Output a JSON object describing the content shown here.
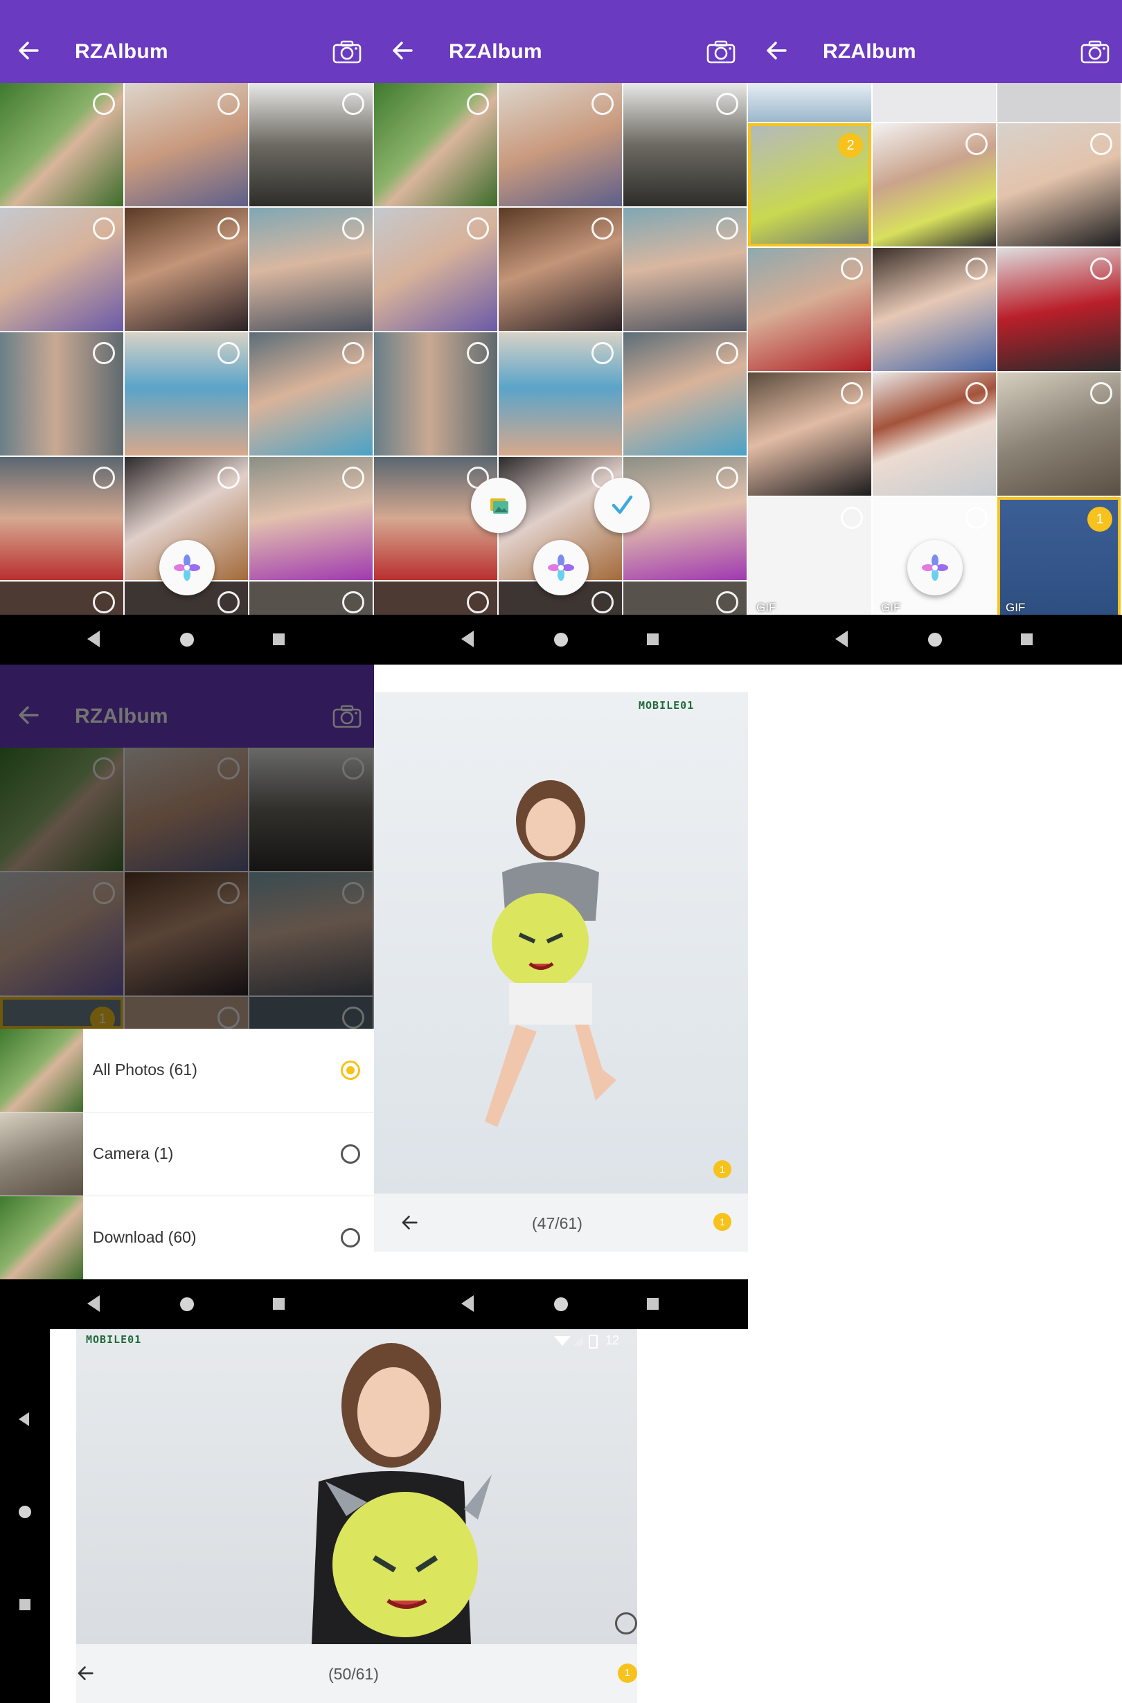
{
  "app": {
    "title": "RZAlbum"
  },
  "icons": {
    "back": "arrow-left-icon",
    "camera": "camera-icon",
    "fab_main": "four-petal-menu-icon",
    "fab_gallery": "gallery-icon",
    "fab_confirm": "checkmark-icon",
    "nav_back": "triangle-back-icon",
    "nav_home": "circle-home-icon",
    "nav_recent": "square-recents-icon"
  },
  "colors": {
    "appbar": "#6a3ac0",
    "accent": "#f6c21b",
    "navbar": "#000000"
  },
  "screen3": {
    "selected_badges": [
      "2",
      "1"
    ],
    "gif_label": "GIF"
  },
  "screen4": {
    "overlay_badge": "1",
    "albums": [
      {
        "name": "All Photos (61)",
        "selected": true
      },
      {
        "name": "Camera (1)",
        "selected": false
      },
      {
        "name": "Download (60)",
        "selected": false
      }
    ]
  },
  "screen5": {
    "counter": "(47/61)",
    "badge": "1",
    "watermark": "MOBILE01"
  },
  "screen6": {
    "counter": "(50/61)",
    "badge": "1",
    "watermark": "MOBILE01",
    "status_time": "12"
  }
}
